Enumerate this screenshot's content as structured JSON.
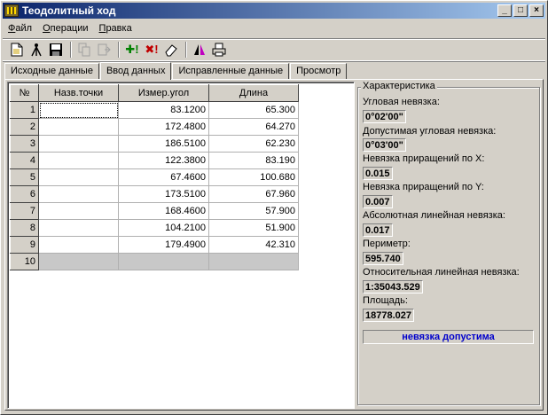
{
  "window": {
    "title": "Теодолитный ход"
  },
  "menu": [
    {
      "u": "Ф",
      "rest": "айл"
    },
    {
      "u": "О",
      "rest": "перации"
    },
    {
      "u": "П",
      "rest": "равка"
    }
  ],
  "toolbar": {
    "icons": [
      "new-doc-icon",
      "tripod-icon",
      "save-icon",
      "copy-icon",
      "paste-icon",
      "add-row-icon",
      "delete-row-icon",
      "eraser-icon",
      "mirror-icon",
      "print-icon"
    ]
  },
  "tabs": [
    "Исходные данные",
    "Ввод данных",
    "Исправленные данные",
    "Просмотр"
  ],
  "grid": {
    "headers": [
      "№",
      "Назв.точки",
      "Измер.угол",
      "Длина"
    ],
    "rows": [
      {
        "n": "1",
        "name": "",
        "angle": "83.1200",
        "length": "65.300"
      },
      {
        "n": "2",
        "name": "",
        "angle": "172.4800",
        "length": "64.270"
      },
      {
        "n": "3",
        "name": "",
        "angle": "186.5100",
        "length": "62.230"
      },
      {
        "n": "4",
        "name": "",
        "angle": "122.3800",
        "length": "83.190"
      },
      {
        "n": "5",
        "name": "",
        "angle": "67.4600",
        "length": "100.680"
      },
      {
        "n": "6",
        "name": "",
        "angle": "173.5100",
        "length": "67.960"
      },
      {
        "n": "7",
        "name": "",
        "angle": "168.4600",
        "length": "57.900"
      },
      {
        "n": "8",
        "name": "",
        "angle": "104.2100",
        "length": "51.900"
      },
      {
        "n": "9",
        "name": "",
        "angle": "179.4900",
        "length": "42.310"
      },
      {
        "n": "10",
        "name": "",
        "angle": "",
        "length": ""
      }
    ]
  },
  "characteristics": {
    "title": "Характеристика",
    "angular_label": "Угловая невязка:",
    "angular_value": "0°02'00\"",
    "allowed_angular_label": "Допустимая угловая невязка:",
    "allowed_angular_value": "0°03'00\"",
    "dx_label": "Невязка приращений по X:",
    "dx_value": "0.015",
    "dy_label": "Невязка приращений по Y:",
    "dy_value": "0.007",
    "abs_label": "Абсолютная линейная невязка:",
    "abs_value": "0.017",
    "perimeter_label": "Периметр:",
    "perimeter_value": "595.740",
    "rel_label": "Относительная линейная невязка:",
    "rel_value": "1:35043.529",
    "area_label": "Площадь:",
    "area_value": "18778.027",
    "status": "невязка допустима"
  }
}
